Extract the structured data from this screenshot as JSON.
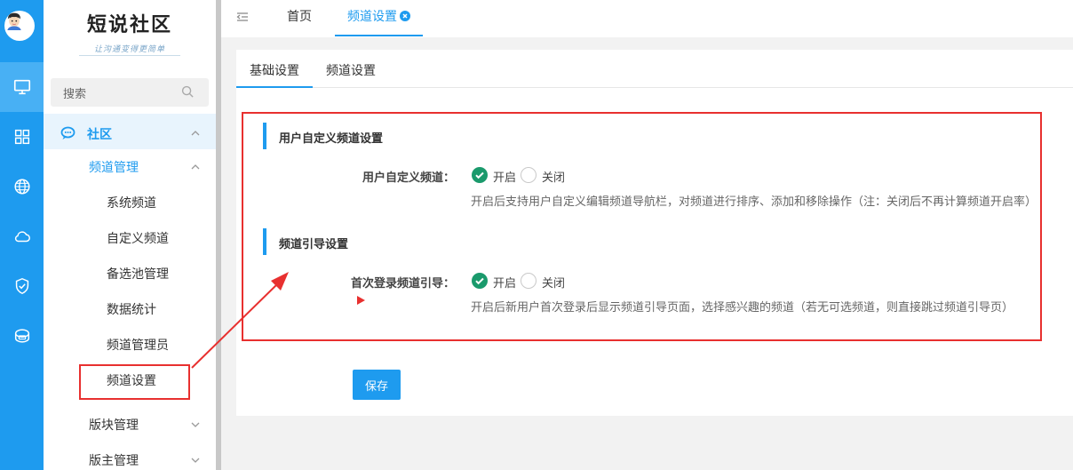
{
  "logo": {
    "title": "短说社区",
    "subtitle": "让沟通变得更简单"
  },
  "search": {
    "placeholder": "搜索"
  },
  "rail": {
    "items": [
      {
        "icon": "monitor-icon",
        "active": true
      },
      {
        "icon": "grid-icon",
        "active": false
      },
      {
        "icon": "globe-icon",
        "active": false
      },
      {
        "icon": "cloud-icon",
        "active": false
      },
      {
        "icon": "shield-check-icon",
        "active": false
      },
      {
        "icon": "database-icon",
        "active": false
      }
    ]
  },
  "sidebar": {
    "group": "社区",
    "submenu": "频道管理",
    "items": [
      "系统频道",
      "自定义频道",
      "备选池管理",
      "数据统计",
      "频道管理员",
      "频道设置"
    ],
    "more": [
      "版块管理",
      "版主管理"
    ]
  },
  "topbar": {
    "home": "首页",
    "active_tab": "频道设置"
  },
  "subtabs": [
    "基础设置",
    "频道设置"
  ],
  "sections": [
    {
      "title": "用户自定义频道设置",
      "label": "用户自定义频道：",
      "on": "开启",
      "off": "关闭",
      "help": "开启后支持用户自定义编辑频道导航栏，对频道进行排序、添加和移除操作（注：关闭后不再计算频道开启率）"
    },
    {
      "title": "频道引导设置",
      "label": "首次登录频道引导：",
      "on": "开启",
      "off": "关闭",
      "help": "开启后新用户首次登录后显示频道引导页面，选择感兴趣的频道（若无可选频道，则直接跳过频道引导页）"
    }
  ],
  "save_label": "保存",
  "colors": {
    "accent": "#1e9bef",
    "annotation": "#e8302f",
    "radio_on": "#1a9a6c"
  }
}
